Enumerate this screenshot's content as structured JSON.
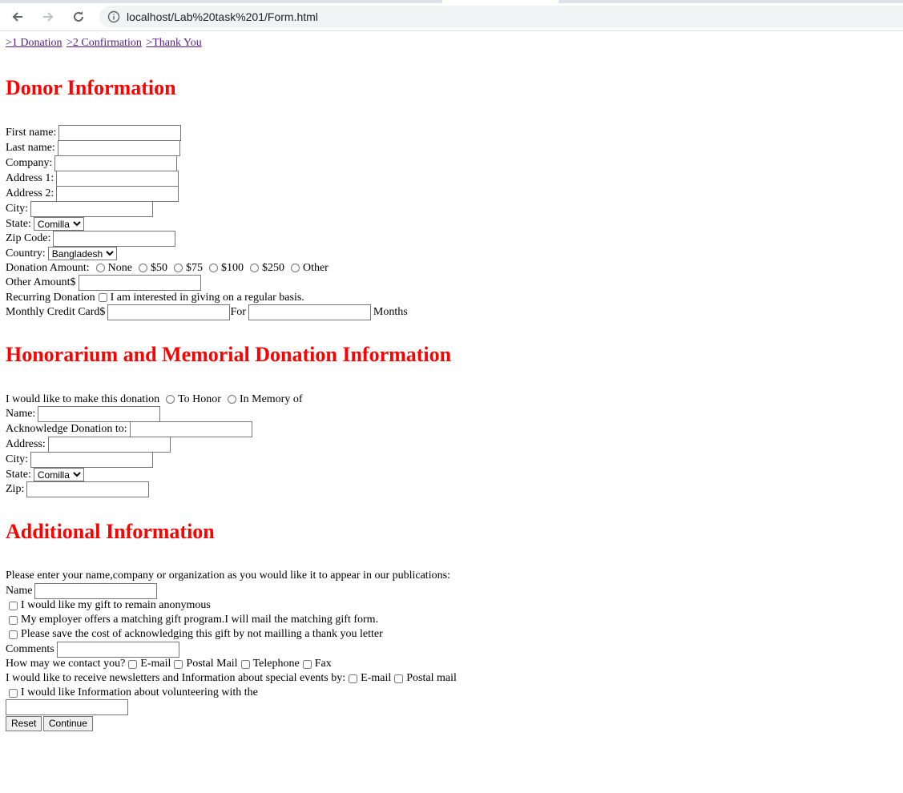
{
  "browser": {
    "url": "localhost/Lab%20task%201/Form.html"
  },
  "steps": [
    ">1 Donation",
    ">2 Confirmation",
    ">Thank You"
  ],
  "donor": {
    "heading": "Donor Information",
    "first_name": "First name:",
    "last_name": "Last name:",
    "company": "Company:",
    "address1": "Address 1:",
    "address2": "Address 2:",
    "city": "City:",
    "state": "State:",
    "state_value": "Comilla",
    "zip": "Zip Code:",
    "country": "Country:",
    "country_value": "Bangladesh",
    "donation_amount": "Donation Amount:",
    "amounts": [
      "None",
      "$50",
      "$75",
      "$100",
      "$250",
      "Other"
    ],
    "other_amount": "Other Amount$",
    "recurring": "Recurring Donation",
    "recurring_check": "I am interested in giving on a regular basis.",
    "monthly": "Monthly Credit Card$",
    "for": "For",
    "months": "Months"
  },
  "honor": {
    "heading": "Honorarium and Memorial Donation Information",
    "intro": "I would like to make this donation",
    "to_honor": "To Honor",
    "in_memory": "In Memory of",
    "name": "Name:",
    "acknowledge": "Acknowledge Donation to:",
    "address": "Address:",
    "city": "City:",
    "state": "State:",
    "state_value": "Comilla",
    "zip": "Zip:"
  },
  "additional": {
    "heading": "Additional Information",
    "intro": "Please enter your name,company or organization as you would like it to appear in our publications:",
    "name": "Name",
    "anonymous": "I would like my gift to remain anonymous",
    "employer": "My employer offers a matching gift program.I will mail the matching gift form.",
    "save_cost": "Please save the cost of acknowledging this gift by not mailling a thank you letter",
    "comments": "Comments",
    "contact": "How may we contact you?",
    "contact_options": [
      "E-mail",
      "Postal Mail",
      "Telephone",
      "Fax"
    ],
    "newsletter": "I would like to receive newsletters and Information about special events by:",
    "newsletter_options": [
      "E-mail",
      "Postal mail"
    ],
    "volunteer": "I would like Information about volunteering with the"
  },
  "buttons": {
    "reset": "Reset",
    "continue": "Continue"
  }
}
